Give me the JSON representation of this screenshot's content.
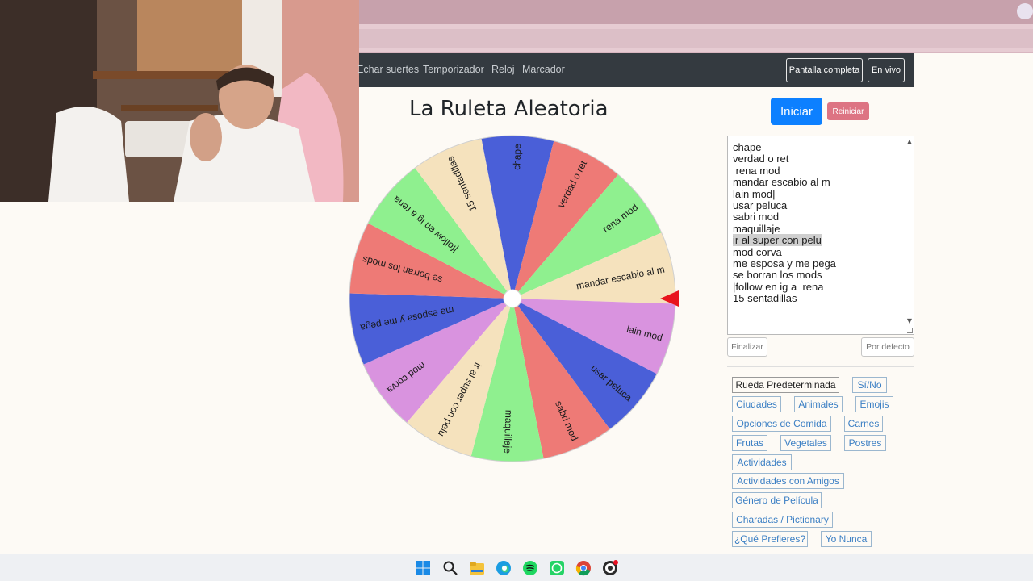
{
  "navbar": {
    "links": [
      "Echar suertes",
      "Temporizador",
      "Reloj",
      "Marcador"
    ],
    "buttons": [
      "Pantalla completa",
      "En vivo"
    ]
  },
  "page": {
    "title": "La Ruleta Aleatoria",
    "start_label": "Iniciar",
    "reset_label": "Reiniciar"
  },
  "wheel": {
    "segments": [
      {
        "label": "chape",
        "color": "#4a5fd8"
      },
      {
        "label": "verdad o ret",
        "color": "#ee7a76"
      },
      {
        "label": "rena mod",
        "color": "#8ff08f"
      },
      {
        "label": "mandar escabio al m",
        "color": "#f5e2bd"
      },
      {
        "label": "lain mod",
        "color": "#d993df"
      },
      {
        "label": "usar peluca",
        "color": "#4a5fd8"
      },
      {
        "label": "sabri mod",
        "color": "#ee7a76"
      },
      {
        "label": "maquillaje",
        "color": "#8ff08f"
      },
      {
        "label": "ir al super con pelu",
        "color": "#f5e2bd"
      },
      {
        "label": "mod corva",
        "color": "#d993df"
      },
      {
        "label": "me esposa y me pega",
        "color": "#4a5fd8"
      },
      {
        "label": "se borran los mods",
        "color": "#ee7a76"
      },
      {
        "label": "|follow en ig a  rena",
        "color": "#8ff08f"
      },
      {
        "label": "15 sentadillas",
        "color": "#f5e2bd"
      }
    ],
    "pointer_color": "#e8141c",
    "center_color": "#ffffff"
  },
  "options_text": {
    "lines": [
      "chape",
      "verdad o ret",
      " rena mod",
      "mandar escabio al m",
      "lain mod|",
      "usar peluca",
      "sabri mod",
      "maquillaje",
      "ir al super con pelu",
      "mod corva",
      "me esposa y me pega",
      "se borran los mods",
      "|follow en ig a  rena",
      "15 sentadillas"
    ],
    "selected_line": "ir al super con pelu"
  },
  "actions": {
    "finish_label": "Finalizar",
    "default_label": "Por defecto"
  },
  "presets": [
    "Rueda Predeterminada",
    "Sí/No",
    "Ciudades",
    "Animales",
    "Emojis",
    "Opciones de Comida",
    "Carnes",
    "Frutas",
    "Vegetales",
    "Postres",
    "Actividades",
    "Actividades con Amigos",
    "Género de Película",
    "Charadas / Pictionary",
    "¿Qué Prefieres?",
    "Yo Nunca"
  ],
  "taskbar": {
    "icons": [
      "windows-start-icon",
      "search-icon",
      "file-explorer-icon",
      "edge-icon",
      "spotify-icon",
      "whatsapp-icon",
      "chrome-icon",
      "obs-icon"
    ]
  }
}
